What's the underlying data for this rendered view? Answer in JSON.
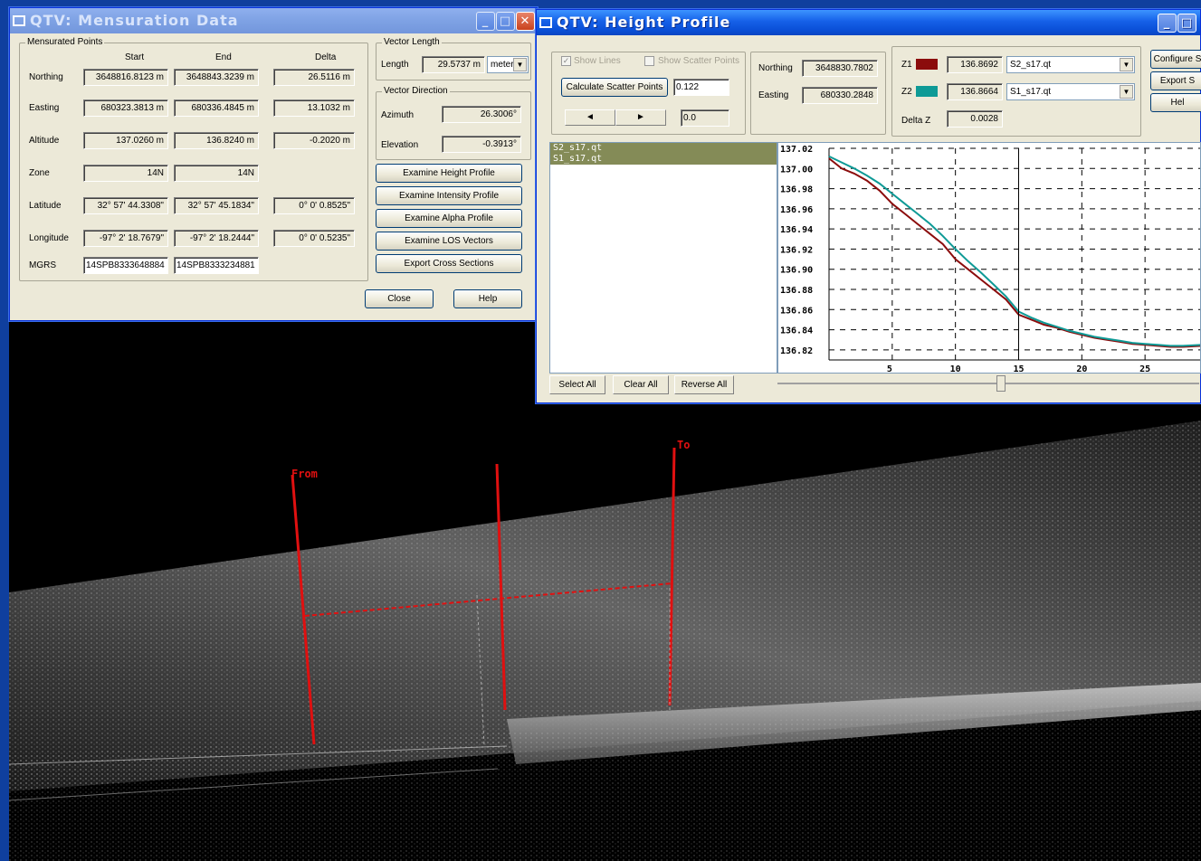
{
  "scene": {
    "from_label": "From",
    "to_label": "To"
  },
  "mensuration": {
    "title": "QTV: Mensuration Data",
    "points_group": "Mensurated Points",
    "col_start": "Start",
    "col_end": "End",
    "col_delta": "Delta",
    "rows": [
      {
        "label": "Northing",
        "start": "3648816.8123 m",
        "end": "3648843.3239 m",
        "delta": "26.5116 m"
      },
      {
        "label": "Easting",
        "start": "680323.3813 m",
        "end": "680336.4845 m",
        "delta": "13.1032 m"
      },
      {
        "label": "Altitude",
        "start": "137.0260 m",
        "end": "136.8240 m",
        "delta": "-0.2020 m"
      },
      {
        "label": "Zone",
        "start": "14N",
        "end": "14N",
        "delta": ""
      },
      {
        "label": "Latitude",
        "start": "32° 57' 44.3308\"",
        "end": "32° 57' 45.1834\"",
        "delta": "0° 0' 0.8525\""
      },
      {
        "label": "Longitude",
        "start": "-97° 2' 18.7679\"",
        "end": "-97° 2' 18.2444\"",
        "delta": "0° 0' 0.5235\""
      },
      {
        "label": "MGRS",
        "start": "14SPB8333648884",
        "end": "14SPB8333234881",
        "delta": ""
      }
    ],
    "vector_length_group": "Vector Length",
    "length_label": "Length",
    "length_value": "29.5737 m",
    "length_unit": "meter",
    "vector_direction_group": "Vector Direction",
    "azimuth_label": "Azimuth",
    "azimuth_value": "26.3006°",
    "elevation_label": "Elevation",
    "elevation_value": "-0.3913°",
    "buttons": [
      "Examine Height Profile",
      "Examine Intensity Profile",
      "Examine Alpha Profile",
      "Examine LOS Vectors",
      "Export Cross Sections"
    ],
    "close_label": "Close",
    "help_label": "Help"
  },
  "height_profile": {
    "title": "QTV: Height Profile",
    "show_lines_label": "Show Lines",
    "show_scatter_label": "Show Scatter Points",
    "calc_scatter_label": "Calculate Scatter Points",
    "calc_scatter_value": "0.122",
    "step_value": "0.0",
    "northing_label": "Northing",
    "northing_value": "3648830.7802",
    "easting_label": "Easting",
    "easting_value": "680330.2848",
    "z1_label": "Z1",
    "z1_value": "136.8692",
    "z1_file": "S2_s17.qt",
    "z1_color": "#8b0c0c",
    "z2_label": "Z2",
    "z2_value": "136.8664",
    "z2_file": "S1_s17.qt",
    "z2_color": "#0e9a96",
    "deltaz_label": "Delta Z",
    "deltaz_value": "0.0028",
    "configure_label": "Configure S",
    "export_label": "Export S",
    "help_label": "Hel",
    "files": [
      "S2_s17.qt",
      "S1_s17.qt"
    ],
    "select_all_label": "Select All",
    "clear_all_label": "Clear All",
    "reverse_all_label": "Reverse All"
  },
  "chart_data": {
    "type": "line",
    "title": "",
    "xlabel": "",
    "ylabel": "",
    "xlim": [
      0,
      29.5
    ],
    "ylim": [
      136.81,
      137.02
    ],
    "x_ticks": [
      5,
      10,
      15,
      20,
      25
    ],
    "y_ticks": [
      137.02,
      137.0,
      136.98,
      136.96,
      136.94,
      136.92,
      136.9,
      136.88,
      136.86,
      136.84,
      136.82
    ],
    "y_tick_labels": [
      "137.02",
      "137.00",
      "136.98",
      "136.96",
      "136.94",
      "136.92",
      "136.90",
      "136.88",
      "136.86",
      "136.84",
      "136.82"
    ],
    "grid": true,
    "series": [
      {
        "name": "S2_s17.qt",
        "color": "#8b0c0c",
        "x": [
          0,
          1,
          2,
          3,
          4,
          5,
          6,
          7,
          8,
          9,
          10,
          11,
          12,
          13,
          14,
          15,
          16,
          17,
          18,
          19,
          20,
          21,
          22,
          23,
          24,
          25,
          26,
          27,
          28,
          29.5
        ],
        "y": [
          137.01,
          137.0,
          136.995,
          136.988,
          136.978,
          136.965,
          136.955,
          136.945,
          136.935,
          136.925,
          136.91,
          136.9,
          136.89,
          136.88,
          136.87,
          136.855,
          136.85,
          136.845,
          136.842,
          136.838,
          136.835,
          136.832,
          136.83,
          136.828,
          136.826,
          136.825,
          136.824,
          136.823,
          136.823,
          136.824
        ]
      },
      {
        "name": "S1_s17.qt",
        "color": "#0e9a96",
        "x": [
          0,
          1,
          2,
          3,
          4,
          5,
          6,
          7,
          8,
          9,
          10,
          11,
          12,
          13,
          14,
          15,
          16,
          17,
          18,
          19,
          20,
          21,
          22,
          23,
          24,
          25,
          26,
          27,
          28,
          29.5
        ],
        "y": [
          137.012,
          137.006,
          137.0,
          136.993,
          136.985,
          136.975,
          136.965,
          136.955,
          136.945,
          136.933,
          136.92,
          136.908,
          136.897,
          136.885,
          136.873,
          136.858,
          136.852,
          136.847,
          136.843,
          136.839,
          136.836,
          136.833,
          136.831,
          136.829,
          136.827,
          136.826,
          136.825,
          136.824,
          136.824,
          136.825
        ]
      }
    ]
  }
}
